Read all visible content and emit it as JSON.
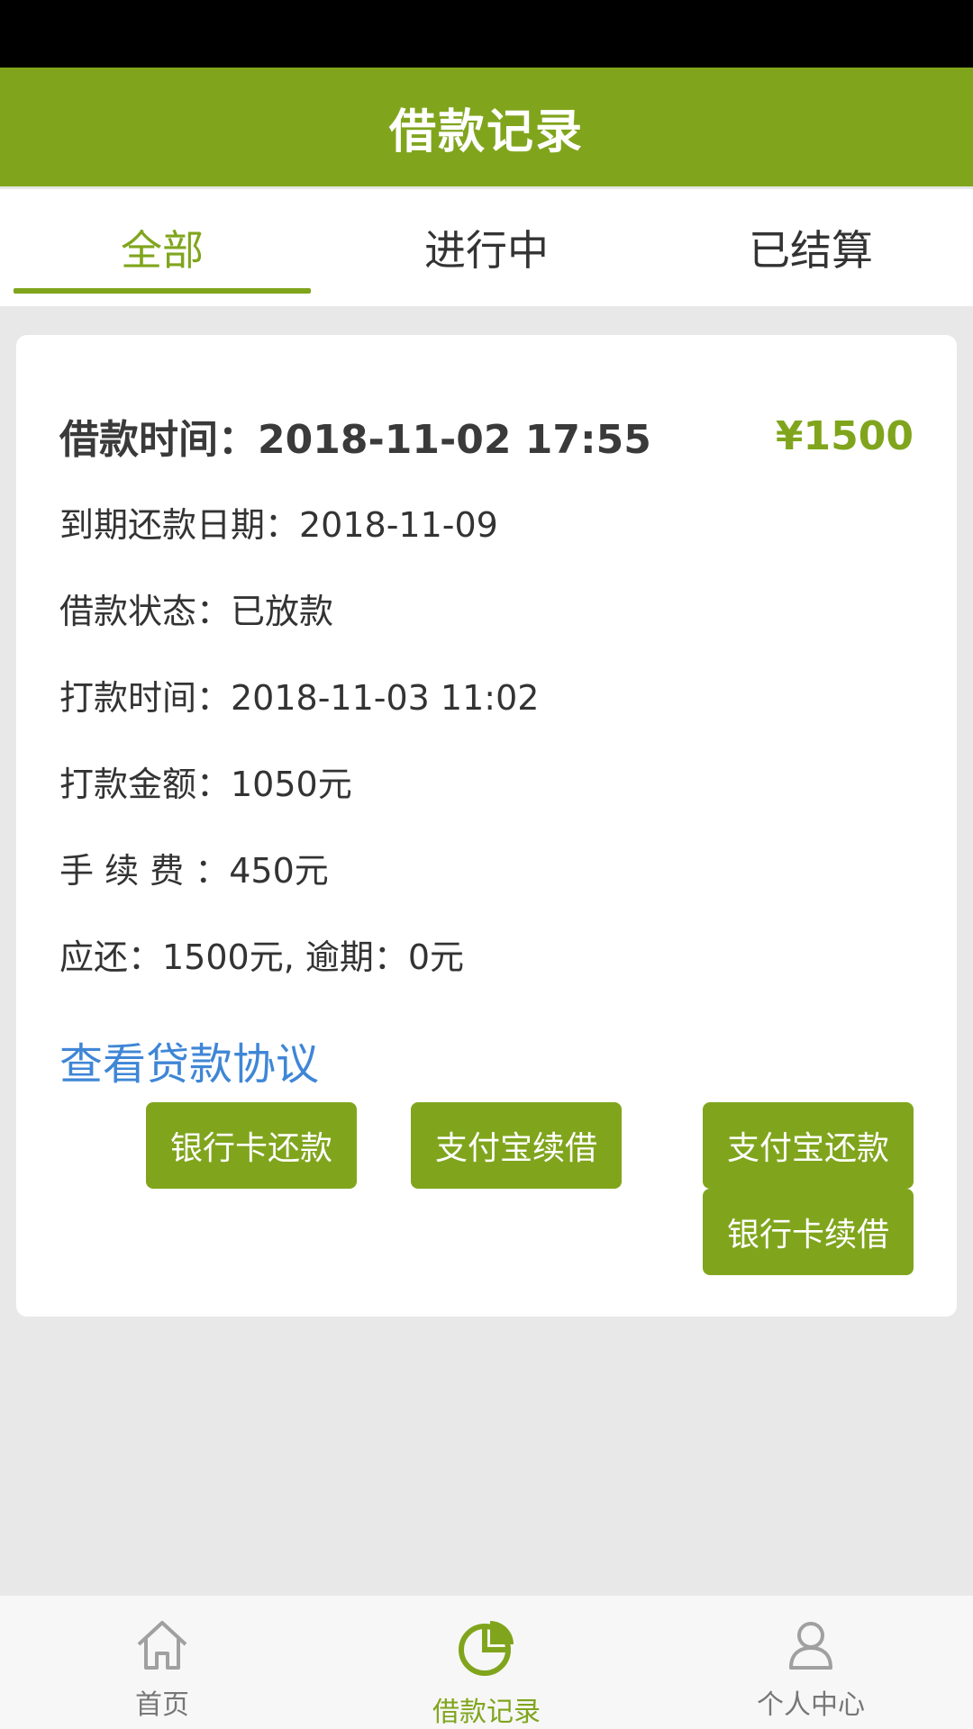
{
  "header": {
    "title": "借款记录"
  },
  "tabs": [
    {
      "label": "全部",
      "active": true
    },
    {
      "label": "进行中",
      "active": false
    },
    {
      "label": "已结算",
      "active": false
    }
  ],
  "card": {
    "borrow_time": "借款时间：2018-11-02 17:55",
    "amount": "¥1500",
    "due_date": "到期还款日期：2018-11-09",
    "status": "借款状态：已放款",
    "transfer_time": "打款时间：2018-11-03 11:02",
    "transfer_amount": "打款金额：1050元",
    "fee": "手 续 费 ：450元",
    "repay": "应还：1500元, 逾期：0元",
    "agreement_link": "查看贷款协议",
    "buttons": {
      "bank_repay": "银行卡还款",
      "alipay_renew": "支付宝续借",
      "alipay_repay": "支付宝还款",
      "bank_renew": "银行卡续借"
    }
  },
  "nav": [
    {
      "label": "首页",
      "icon": "home-icon",
      "active": false
    },
    {
      "label": "借款记录",
      "icon": "pie-chart-icon",
      "active": true
    },
    {
      "label": "个人中心",
      "icon": "user-icon",
      "active": false
    }
  ],
  "colors": {
    "brand_green": "#80a51d",
    "link_blue": "#3f86d6",
    "background": "#e8e8e8"
  }
}
